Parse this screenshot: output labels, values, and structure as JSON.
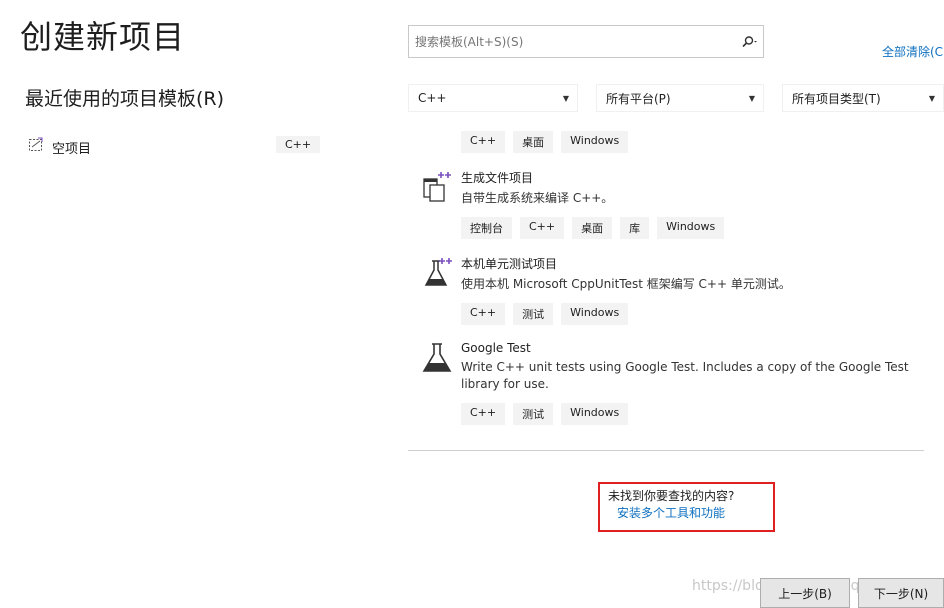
{
  "page": {
    "title": "创建新项目"
  },
  "recent": {
    "title": "最近使用的项目模板(R)",
    "items": [
      {
        "label": "空项目",
        "tag": "C++"
      }
    ]
  },
  "search": {
    "placeholder": "搜索模板(Alt+S)(S)",
    "icon": "search-icon"
  },
  "clear_all": "全部清除(C)",
  "filters": {
    "language": "C++",
    "platform": "所有平台(P)",
    "project_type": "所有项目类型(T)"
  },
  "templates": [
    {
      "tags": [
        "C++",
        "桌面",
        "Windows"
      ]
    },
    {
      "name": "生成文件项目",
      "description": "自带生成系统来编译 C++。",
      "tags": [
        "控制台",
        "C++",
        "桌面",
        "库",
        "Windows"
      ],
      "icon": "makefile-project-icon"
    },
    {
      "name": "本机单元测试项目",
      "description": "使用本机 Microsoft CppUnitTest 框架编写 C++ 单元测试。",
      "tags": [
        "C++",
        "测试",
        "Windows"
      ],
      "icon": "native-unit-test-icon"
    },
    {
      "name": "Google Test",
      "description": "Write C++ unit tests using Google Test. Includes a copy of the Google Test library for use.",
      "tags": [
        "C++",
        "测试",
        "Windows"
      ],
      "icon": "flask-icon"
    }
  ],
  "not_found": {
    "question": "未找到你要查找的内容?",
    "link": "安装多个工具和功能"
  },
  "footer": {
    "back": "上一步(B)",
    "next": "下一步(N)",
    "watermark": "https://blog.csdn.net/qq_38282939"
  }
}
